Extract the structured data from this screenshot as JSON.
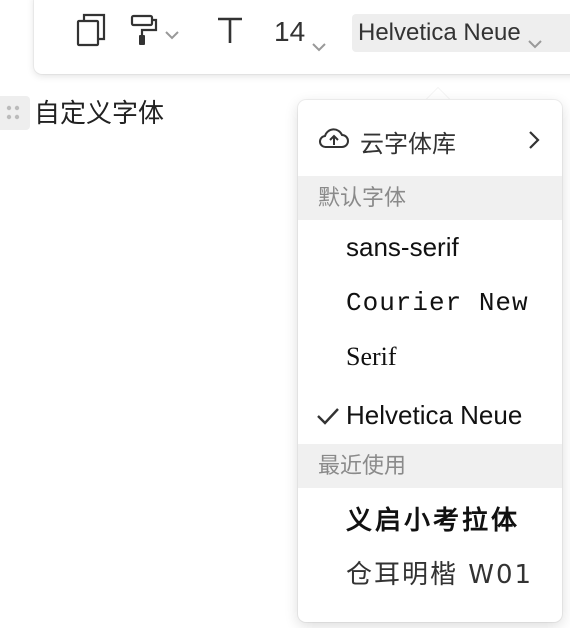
{
  "toolbar": {
    "icons": [
      "copy-icon",
      "format-painter-icon",
      "chevron-down-icon",
      "text-icon",
      "chevron-down-icon"
    ],
    "font_size": "14",
    "font_family": "Helvetica Neue"
  },
  "document": {
    "text": "自定义字体"
  },
  "dropdown": {
    "cloud_label": "云字体库",
    "section_default": "默认字体",
    "default_fonts": [
      "sans-serif",
      "Courier New",
      "Serif",
      "Helvetica Neue"
    ],
    "selected_font": "Helvetica Neue",
    "section_recent": "最近使用",
    "recent_fonts": [
      "义启小考拉体",
      "仓耳明楷 W01"
    ]
  }
}
